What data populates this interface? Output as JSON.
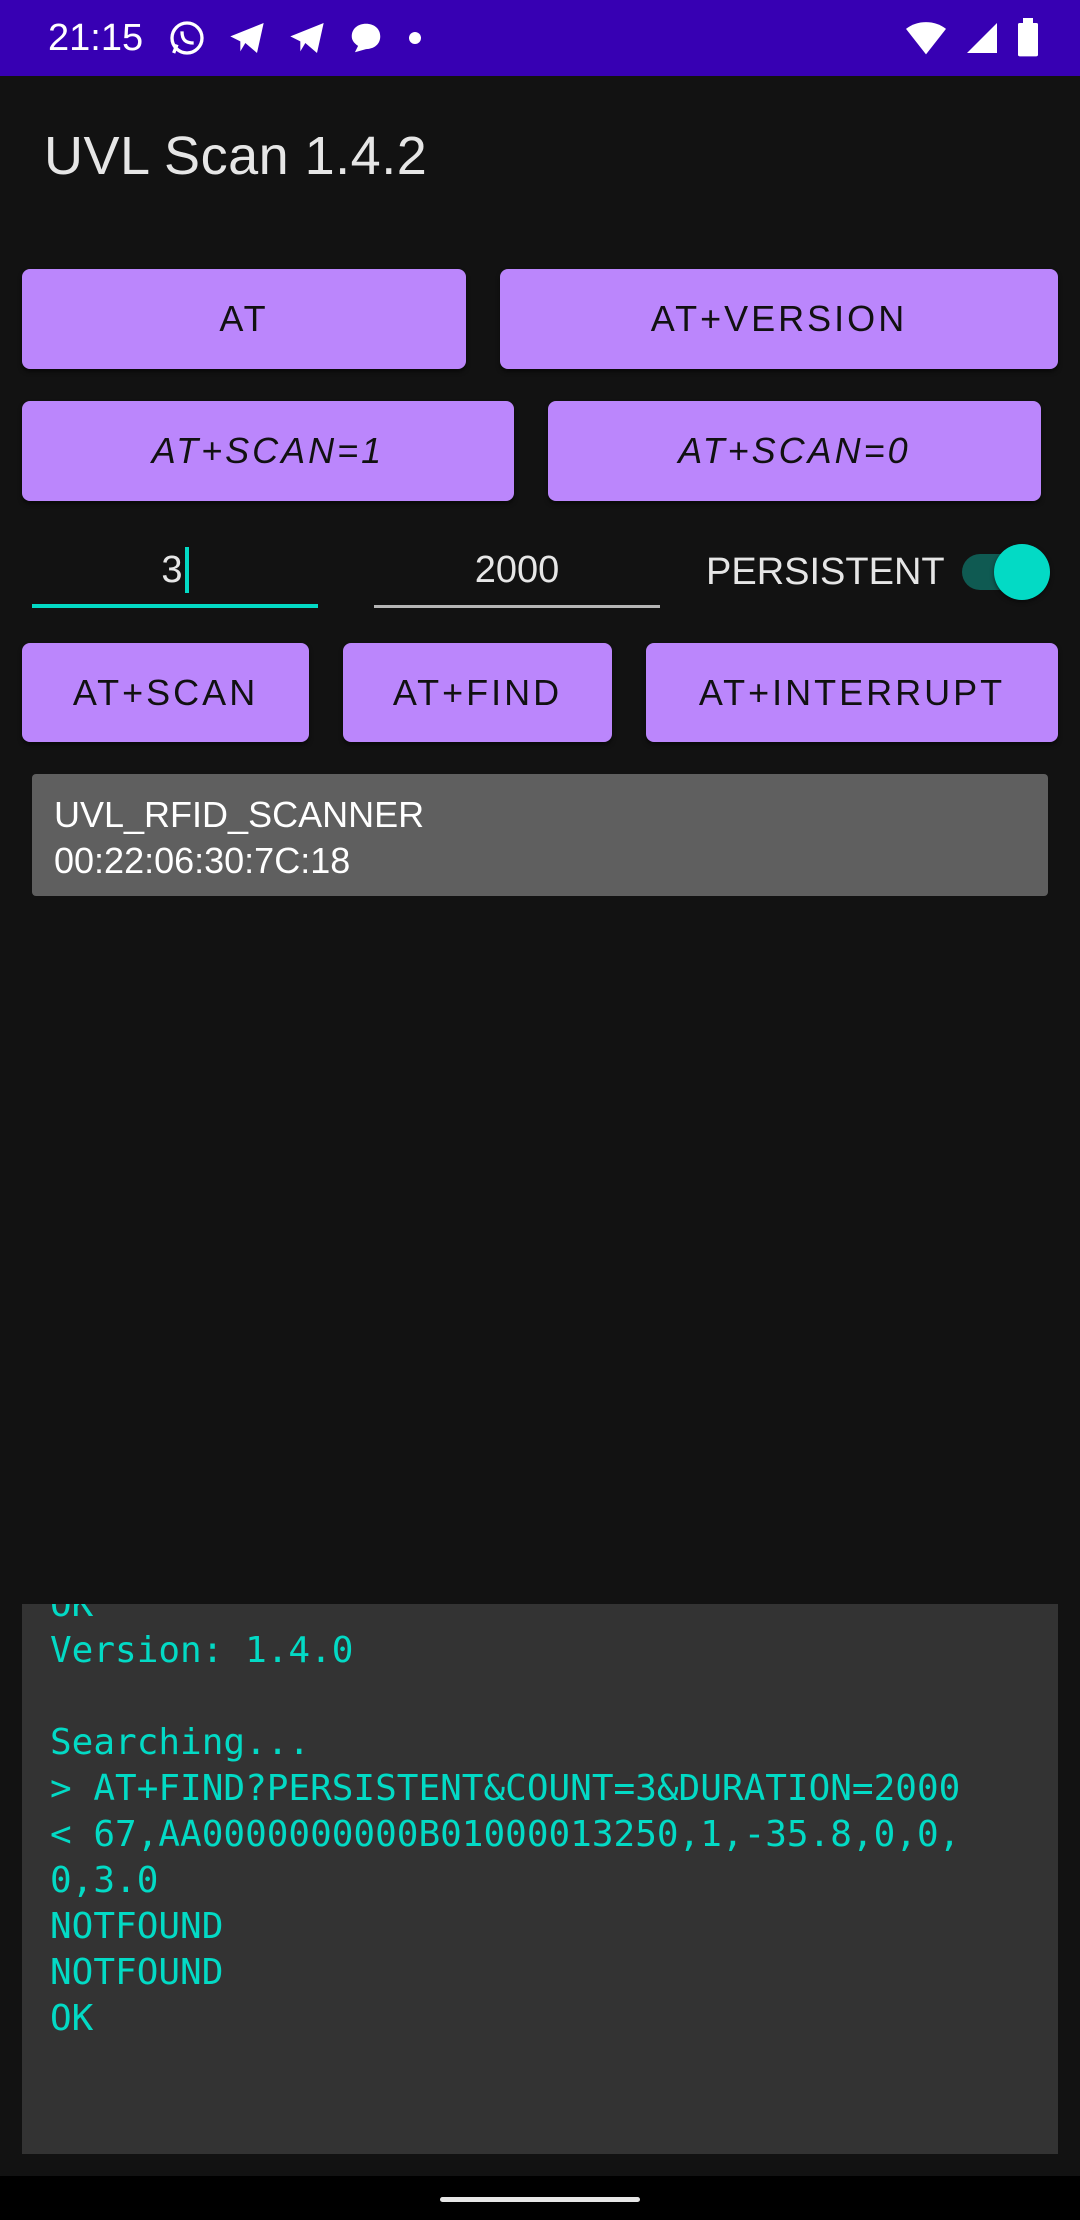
{
  "status_bar": {
    "time": "21:15",
    "left_icons": [
      "whatsapp-icon",
      "telegram-icon",
      "telegram-icon",
      "chat-bubble-icon",
      "dot-icon"
    ],
    "right_icons": [
      "wifi-icon",
      "cell-signal-icon",
      "battery-icon"
    ],
    "background": "#3700B3"
  },
  "app_bar": {
    "title": "UVL Scan 1.4.2"
  },
  "buttons": {
    "at": "AT",
    "at_version": "AT+VERSION",
    "at_scan_1": "AT+SCAN=1",
    "at_scan_0": "AT+SCAN=0",
    "at_scan": "AT+SCAN",
    "at_find": "AT+FIND",
    "at_interrupt": "AT+INTERRUPT"
  },
  "inputs": {
    "count": "3",
    "duration": "2000"
  },
  "persistent": {
    "label": "PERSISTENT",
    "enabled": true
  },
  "device": {
    "name": "UVL_RFID_SCANNER",
    "address": "00:22:06:30:7C:18"
  },
  "console": {
    "lines": [
      "OK",
      "Version: 1.4.0",
      "",
      "Searching...",
      "> AT+FIND?PERSISTENT&COUNT=3&DURATION=2000",
      "< 67,AA0000000000B01000013250,1,-35.8,0,0,",
      "0,3.0",
      "NOTFOUND",
      "NOTFOUND",
      "OK"
    ]
  },
  "colors": {
    "accent": "#BB86FC",
    "secondary": "#03DAC5",
    "background": "#121212"
  }
}
